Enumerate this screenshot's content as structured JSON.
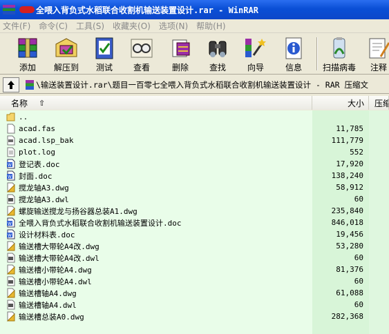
{
  "window": {
    "title": "全喂入背负式水稻联合收割机输送装置设计.rar - WinRAR"
  },
  "menu": [
    "文件(F)",
    "命令(C)",
    "工具(S)",
    "收藏夹(O)",
    "选项(N)",
    "帮助(H)"
  ],
  "toolbar": [
    {
      "label": "添加",
      "icon": "add-archive-icon"
    },
    {
      "label": "解压到",
      "icon": "extract-to-icon"
    },
    {
      "label": "测试",
      "icon": "test-icon"
    },
    {
      "label": "查看",
      "icon": "view-icon"
    },
    {
      "label": "删除",
      "icon": "delete-icon"
    },
    {
      "label": "查找",
      "icon": "find-icon"
    },
    {
      "label": "向导",
      "icon": "wizard-icon"
    },
    {
      "label": "信息",
      "icon": "info-icon"
    },
    {
      "label": "扫描病毒",
      "icon": "virus-scan-icon"
    },
    {
      "label": "注释",
      "icon": "comment-icon"
    }
  ],
  "path": {
    "text": "\\输送装置设计.rar\\题目一百零七全喂入背负式水稻联合收割机输送装置设计 - RAR 压缩文"
  },
  "columns": {
    "name": "名称",
    "size": "大小",
    "packed": "压缩"
  },
  "files": [
    {
      "name": "..",
      "size": "",
      "type": "folder-up"
    },
    {
      "name": "acad.fas",
      "size": "11,785",
      "type": "file"
    },
    {
      "name": "acad.lsp_bak",
      "size": "111,779",
      "type": "file-bak"
    },
    {
      "name": "plot.log",
      "size": "552",
      "type": "text"
    },
    {
      "name": "登记表.doc",
      "size": "17,920",
      "type": "doc"
    },
    {
      "name": "封面.doc",
      "size": "138,240",
      "type": "doc"
    },
    {
      "name": "搅龙轴A3.dwg",
      "size": "58,912",
      "type": "dwg"
    },
    {
      "name": "搅龙轴A3.dwl",
      "size": "60",
      "type": "dwl"
    },
    {
      "name": "螺旋输送搅龙与扬谷器总装A1.dwg",
      "size": "235,840",
      "type": "dwg"
    },
    {
      "name": "全喂入背负式水稻联合收割机输送装置设计.doc",
      "size": "846,018",
      "type": "doc"
    },
    {
      "name": "设计材料表.doc",
      "size": "19,456",
      "type": "doc"
    },
    {
      "name": "输送槽大带轮A4改.dwg",
      "size": "53,280",
      "type": "dwg"
    },
    {
      "name": "输送槽大带轮A4改.dwl",
      "size": "60",
      "type": "dwl"
    },
    {
      "name": "输送槽小带轮A4.dwg",
      "size": "81,376",
      "type": "dwg"
    },
    {
      "name": "输送槽小带轮A4.dwl",
      "size": "60",
      "type": "dwl"
    },
    {
      "name": "输送槽轴A4.dwg",
      "size": "61,088",
      "type": "dwg"
    },
    {
      "name": "输送槽轴A4.dwl",
      "size": "60",
      "type": "dwl"
    },
    {
      "name": "输送槽总装A0.dwg",
      "size": "282,368",
      "type": "dwg"
    }
  ]
}
